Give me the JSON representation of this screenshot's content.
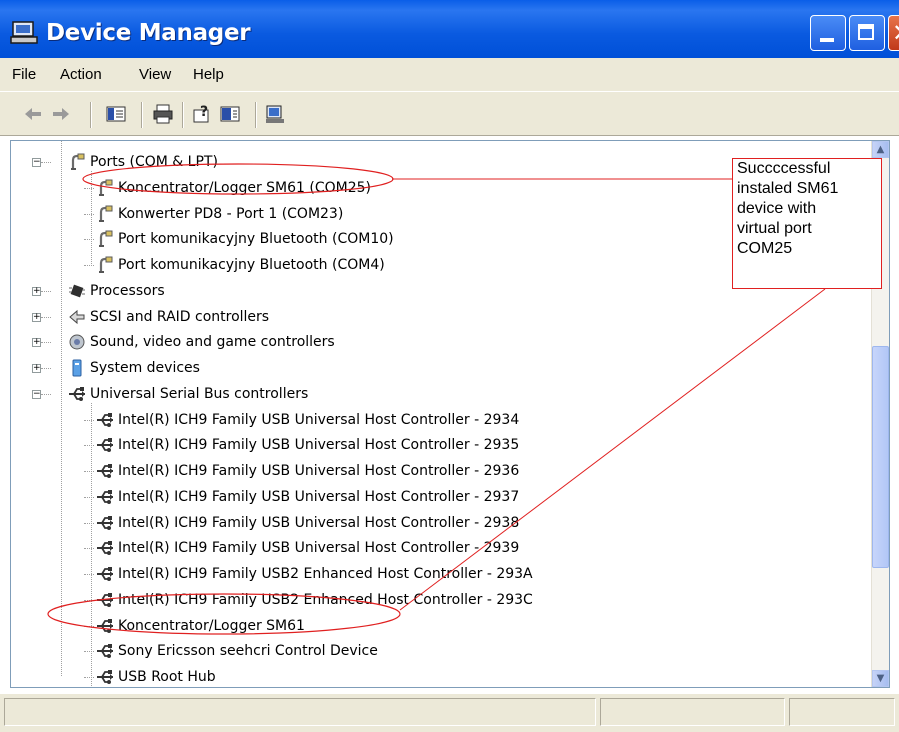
{
  "window": {
    "title": "Device Manager"
  },
  "menu": [
    "File",
    "Action",
    "View",
    "Help"
  ],
  "toolbar_icons": [
    "back-arrow-icon",
    "forward-arrow-icon",
    "show-hide-console-tree-icon",
    "print-icon",
    "help-icon",
    "properties-icon",
    "scan-hardware-icon"
  ],
  "tree": {
    "ports": {
      "label": "Ports (COM & LPT)",
      "children": [
        "Koncentrator/Logger SM61 (COM25)",
        "Konwerter PD8 - Port 1 (COM23)",
        "Port komunikacyjny Bluetooth (COM10)",
        "Port komunikacyjny Bluetooth (COM4)"
      ]
    },
    "processors": "Processors",
    "scsi": "SCSI and RAID controllers",
    "sound": "Sound, video and game controllers",
    "system": "System devices",
    "usb": {
      "label": "Universal Serial Bus controllers",
      "children": [
        "Intel(R) ICH9 Family USB Universal Host Controller - 2934",
        "Intel(R) ICH9 Family USB Universal Host Controller - 2935",
        "Intel(R) ICH9 Family USB Universal Host Controller - 2936",
        "Intel(R) ICH9 Family USB Universal Host Controller - 2937",
        "Intel(R) ICH9 Family USB Universal Host Controller - 2938",
        "Intel(R) ICH9 Family USB Universal Host Controller - 2939",
        "Intel(R) ICH9 Family USB2 Enhanced Host Controller - 293A",
        "Intel(R) ICH9 Family USB2 Enhanced Host Controller - 293C",
        "Koncentrator/Logger SM61",
        "Sony Ericsson seehcri Control Device",
        "USB Root Hub"
      ]
    }
  },
  "annotation": {
    "lines": [
      "Succccessful",
      "instaled SM61",
      "device with",
      "virtual port",
      "COM25"
    ],
    "color": "#e02020"
  },
  "colors": {
    "titlebar": "#0a5ae0",
    "chrome": "#ece9d8"
  }
}
